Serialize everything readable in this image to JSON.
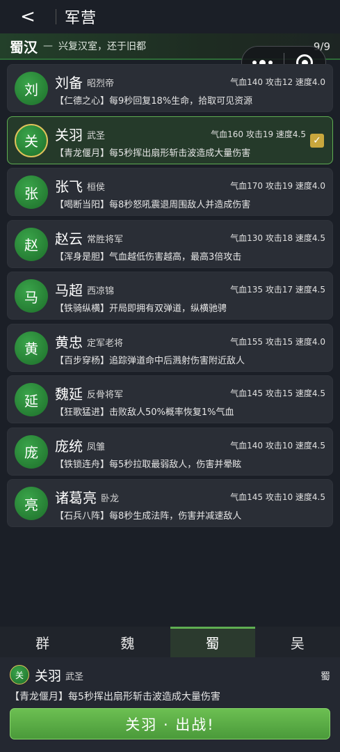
{
  "nav": {
    "back_glyph": "<",
    "title": "军营"
  },
  "faction": {
    "name": "蜀汉",
    "dash": "—",
    "motto": "兴复汉室，还于旧都",
    "count": "9/9"
  },
  "capsule": {
    "more_icon": "more-dots-icon",
    "close_icon": "target-ring-icon"
  },
  "heroes": [
    {
      "avatar": "刘",
      "name": "刘备",
      "title": "昭烈帝",
      "stats": "气血140  攻击12  速度4.0",
      "skill": "【仁德之心】每9秒回复18%生命，拾取可见资源",
      "selected": false
    },
    {
      "avatar": "关",
      "name": "关羽",
      "title": "武圣",
      "stats": "气血160  攻击19  速度4.5",
      "skill": "【青龙偃月】每5秒挥出扇形斩击波造成大量伤害",
      "selected": true
    },
    {
      "avatar": "张",
      "name": "张飞",
      "title": "桓侯",
      "stats": "气血170  攻击19  速度4.0",
      "skill": "【喝断当阳】每8秒怒吼震退周围敌人并造成伤害",
      "selected": false
    },
    {
      "avatar": "赵",
      "name": "赵云",
      "title": "常胜将军",
      "stats": "气血130  攻击18  速度4.5",
      "skill": "【浑身是胆】气血越低伤害越高，最高3倍攻击",
      "selected": false
    },
    {
      "avatar": "马",
      "name": "马超",
      "title": "西凉锦",
      "stats": "气血135  攻击17  速度4.5",
      "skill": "【铁骑纵横】开局即拥有双弹道，纵横驰骋",
      "selected": false
    },
    {
      "avatar": "黄",
      "name": "黄忠",
      "title": "定军老将",
      "stats": "气血155  攻击15  速度4.0",
      "skill": "【百步穿杨】追踪弹道命中后溅射伤害附近敌人",
      "selected": false
    },
    {
      "avatar": "延",
      "name": "魏延",
      "title": "反骨将军",
      "stats": "气血145  攻击15  速度4.5",
      "skill": "【狂歌猛进】击败敌人50%概率恢复1%气血",
      "selected": false
    },
    {
      "avatar": "庞",
      "name": "庞统",
      "title": "凤雏",
      "stats": "气血140  攻击10  速度4.5",
      "skill": "【铁锁连舟】每5秒拉取最弱敌人，伤害并晕眩",
      "selected": false
    },
    {
      "avatar": "亮",
      "name": "诸葛亮",
      "title": "卧龙",
      "stats": "气血145  攻击10  速度4.5",
      "skill": "【石兵八阵】每8秒生成法阵，伤害并减速敌人",
      "selected": false
    }
  ],
  "tabs": [
    {
      "label": "群",
      "active": false
    },
    {
      "label": "魏",
      "active": false
    },
    {
      "label": "蜀",
      "active": true
    },
    {
      "label": "吴",
      "active": false
    }
  ],
  "selected_panel": {
    "avatar": "关",
    "name": "关羽",
    "title": "武圣",
    "faction": "蜀",
    "skill": "【青龙偃月】每5秒挥出扇形斩击波造成大量伤害",
    "button_label": "关羽 · 出战!"
  },
  "colors": {
    "accent": "#5fae52",
    "gold": "#c9a73d",
    "background": "#1b1f27"
  }
}
